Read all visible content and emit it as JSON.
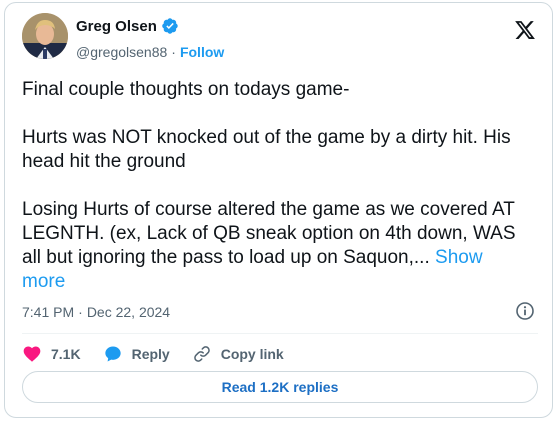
{
  "author": {
    "name": "Greg Olsen",
    "handle": "@gregolsen88",
    "separator": "·",
    "follow_label": "Follow",
    "verified": true
  },
  "tweet": {
    "text": "Final couple thoughts on todays game-\n\nHurts was NOT knocked out of the game by a dirty hit. His head hit the ground\n\nLosing Hurts of course altered the game as we covered AT LEGNTH. (ex, Lack of QB sneak option on 4th down, WAS all but ignoring the pass to load up on Saquon,... ",
    "show_more_label": "Show more",
    "time": "7:41 PM",
    "separator": "·",
    "date": "Dec 22, 2024"
  },
  "actions": {
    "like_count": "7.1K",
    "reply_label": "Reply",
    "copy_link_label": "Copy link"
  },
  "replies_button_label": "Read 1.2K replies",
  "icons": {
    "verified": "verified-badge-icon",
    "brand": "x-logo-icon",
    "info": "info-icon",
    "like": "heart-icon",
    "reply": "speech-bubble-icon",
    "copy_link": "link-icon"
  },
  "colors": {
    "accent": "#1d9bf0",
    "like": "#f91880",
    "text": "#0f1419",
    "secondary": "#536471",
    "border": "#cfd9de"
  }
}
